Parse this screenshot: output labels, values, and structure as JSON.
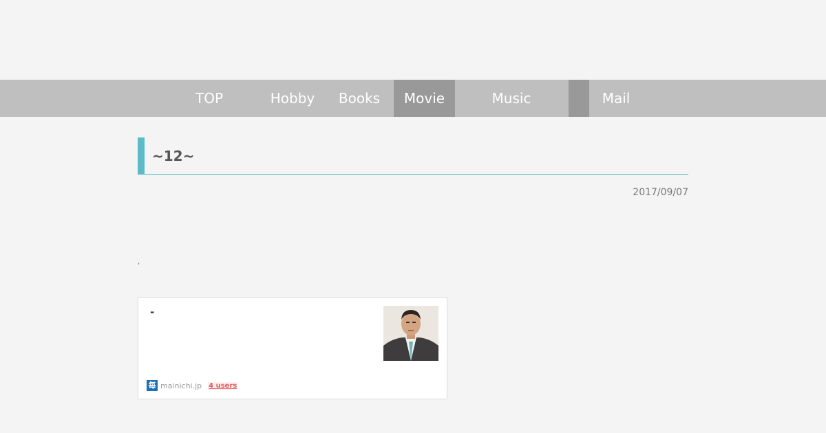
{
  "nav": {
    "items": [
      {
        "label": "TOP",
        "active": false
      },
      {
        "label": "Hobby",
        "active": false
      },
      {
        "label": "Books",
        "active": false
      },
      {
        "label": "Movie",
        "active": true
      },
      {
        "label": "Music",
        "active": false
      },
      {
        "label": "Mail",
        "active": false
      }
    ]
  },
  "post": {
    "title": "~12~",
    "date": "2017/09/07",
    "stray_text": ","
  },
  "embed_card": {
    "title": "-",
    "domain": "mainichi.jp",
    "favicon_text": "毎",
    "users": "4 users"
  },
  "colors": {
    "accent": "#5bbcc8",
    "nav_bg": "#bfbfbf",
    "nav_active": "#999999",
    "users_link": "#e05a5a"
  }
}
